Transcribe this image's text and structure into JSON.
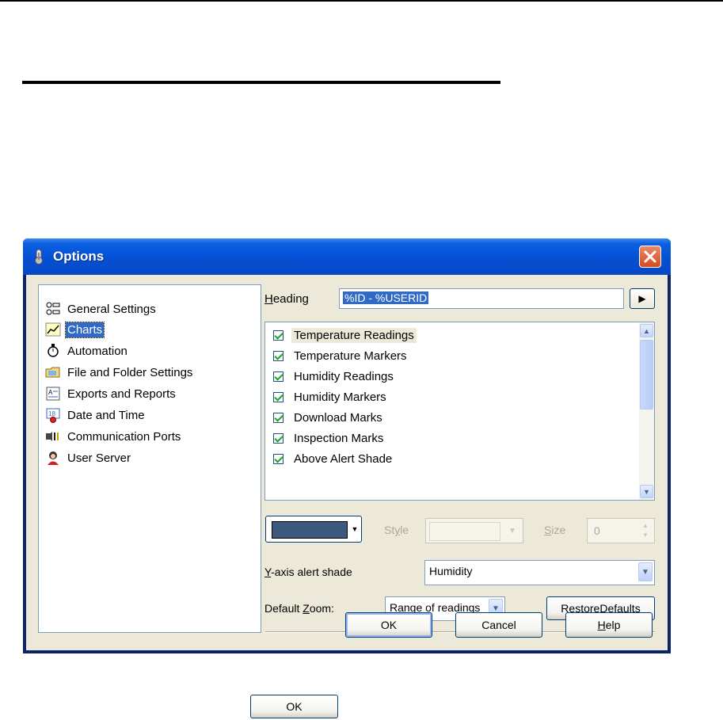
{
  "window": {
    "title": "Options",
    "close_label": "✕"
  },
  "tree": {
    "items": [
      {
        "label": "General Settings",
        "icon": "general-settings-icon"
      },
      {
        "label": "Charts",
        "icon": "charts-icon",
        "selected": true
      },
      {
        "label": "Automation",
        "icon": "automation-icon"
      },
      {
        "label": "File and Folder Settings",
        "icon": "folder-icon"
      },
      {
        "label": "Exports and Reports",
        "icon": "report-icon"
      },
      {
        "label": "Date and Time",
        "icon": "calendar-icon"
      },
      {
        "label": "Communication Ports",
        "icon": "port-icon"
      },
      {
        "label": "User Server",
        "icon": "user-server-icon"
      }
    ]
  },
  "heading": {
    "label_pre": "",
    "label_ul": "H",
    "label_post": "eading",
    "value": "%ID - %USERID",
    "arrow": "▶"
  },
  "checklist": {
    "items": [
      {
        "label": "Temperature Readings",
        "checked": true
      },
      {
        "label": "Temperature Markers",
        "checked": true
      },
      {
        "label": "Humidity Readings",
        "checked": true
      },
      {
        "label": "Humidity Markers",
        "checked": true
      },
      {
        "label": "Download Marks",
        "checked": true
      },
      {
        "label": "Inspection Marks",
        "checked": true
      },
      {
        "label": "Above Alert Shade",
        "checked": true
      }
    ]
  },
  "line": {
    "color": "#3b5a7e",
    "style_pre": "St",
    "style_ul": "y",
    "style_post": "le",
    "size_pre": "",
    "size_ul": "S",
    "size_post": "ize",
    "size_value": "0"
  },
  "yaxis": {
    "label_pre": "",
    "label_ul": "Y",
    "label_post": "-axis alert shade",
    "value": "Humidity"
  },
  "zoom": {
    "label_pre": "Default ",
    "label_ul": "Z",
    "label_post": "oom:",
    "value": "Range of readings"
  },
  "buttons": {
    "restore_pre": "Restore ",
    "restore_ul": "D",
    "restore_post": "efaults",
    "ok": "OK",
    "cancel": "Cancel",
    "help_pre": "",
    "help_ul": "H",
    "help_post": "elp"
  },
  "sample_button": {
    "label": "OK"
  }
}
